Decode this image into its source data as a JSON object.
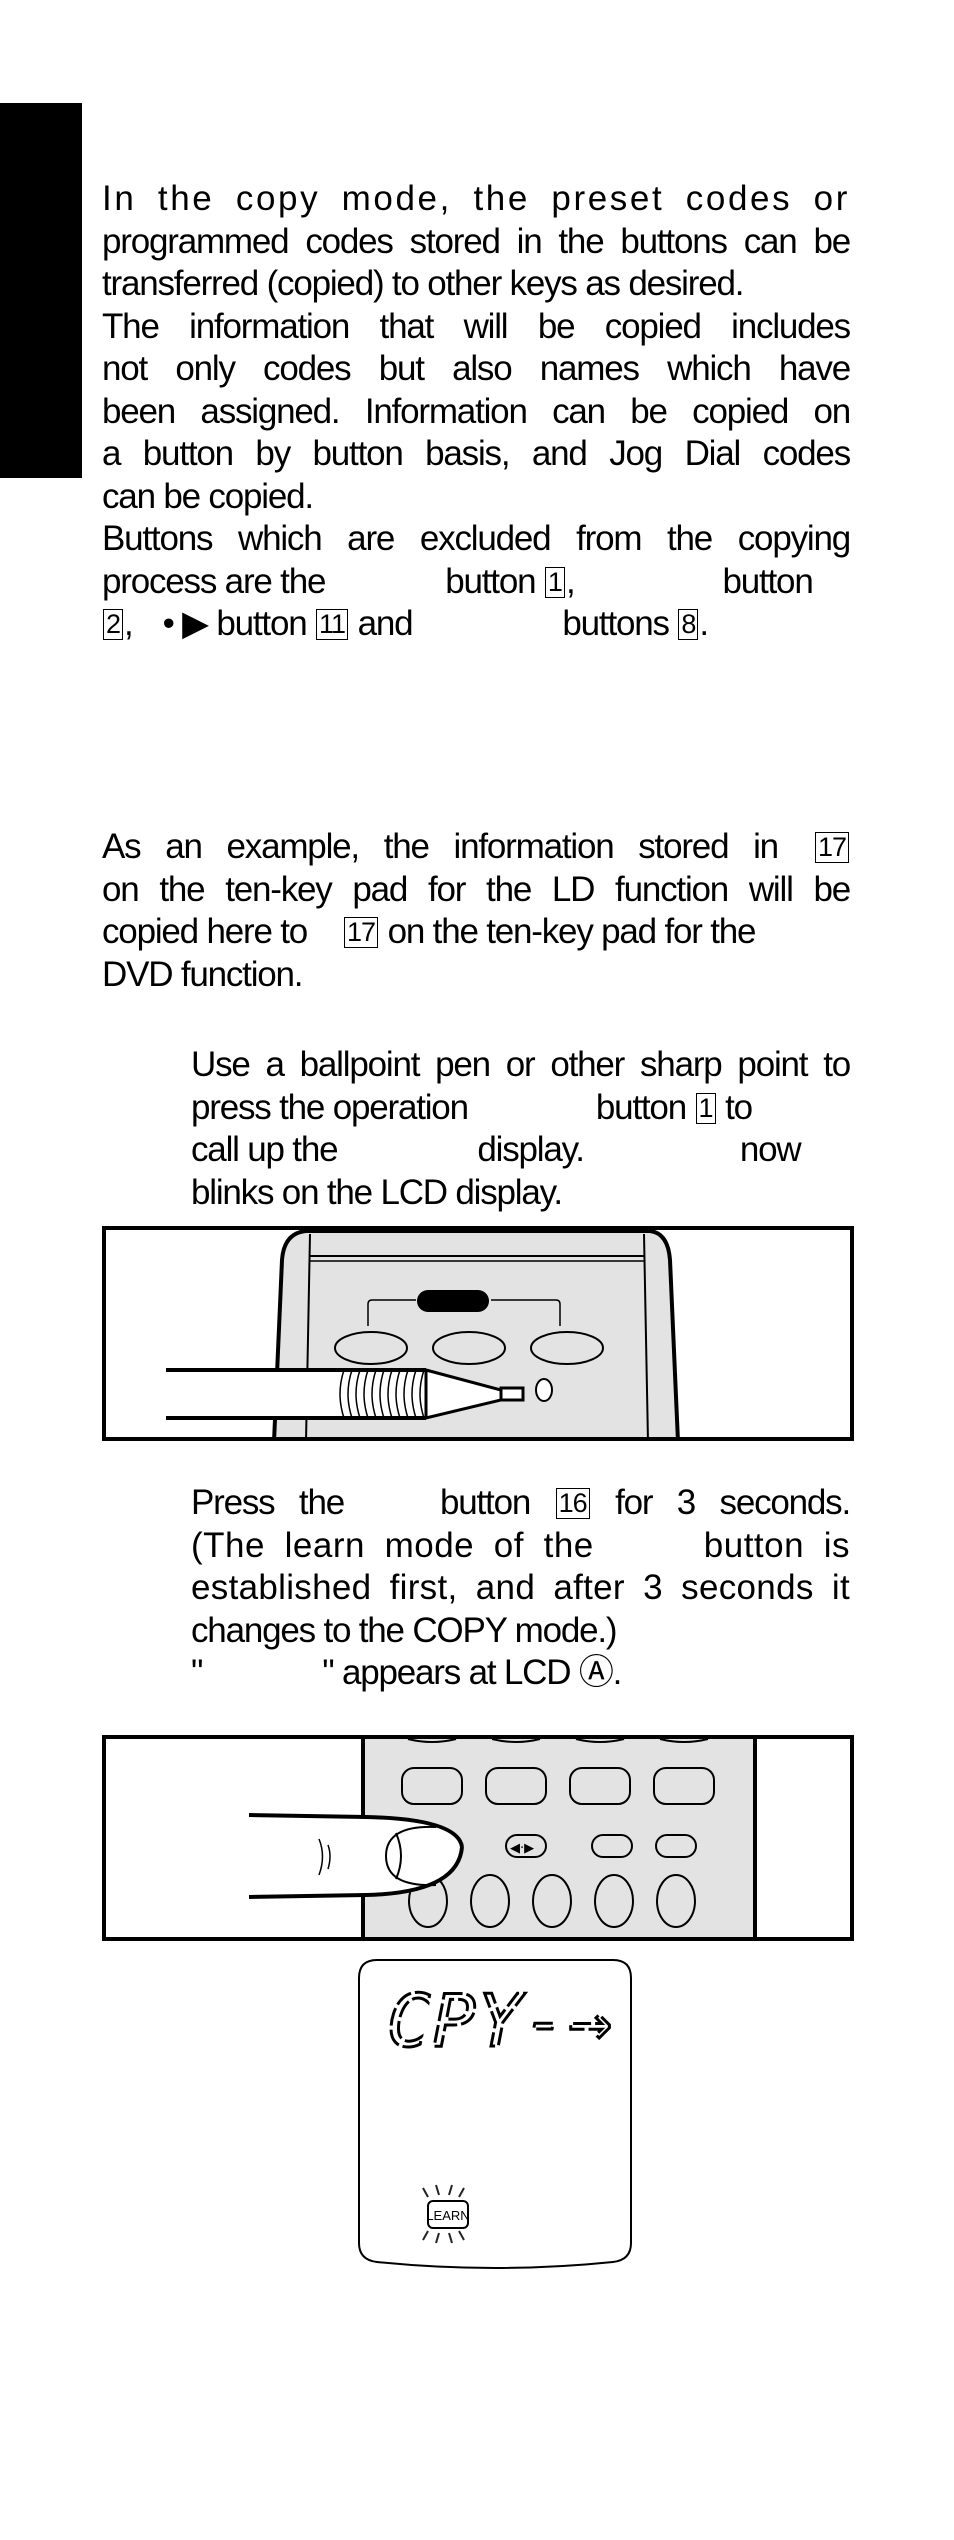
{
  "page": {
    "intro": {
      "lines": [
        "In the copy mode, the preset codes or",
        "programmed codes stored in the buttons can be",
        "transferred (copied) to other keys as desired.",
        "The information that will be copied includes",
        "not only codes but also names which have",
        "been assigned.  Information can be copied on",
        "a button by button basis, and Jog Dial codes",
        "can be copied."
      ]
    },
    "excluded": {
      "line1": "Buttons which are excluded from the copying",
      "line2_a": "process are the",
      "line2_b": "button",
      "line2_num": "1",
      "line2_c": ",",
      "line2_d": "button",
      "line3_num1": "2",
      "line3_a": ",",
      "line3_b": "• ▶ button",
      "line3_num2": "11",
      "line3_c": "and",
      "line3_d": "buttons",
      "line3_num3": "8",
      "line3_e": "."
    },
    "example": {
      "line1_a": "As an example, the information stored in",
      "line1_num": "17",
      "line2": "on the ten-key pad for the LD function will be",
      "line3_a": "copied here to",
      "line3_num": "17",
      "line3_b": "on the ten-key pad for the",
      "line4": "DVD function."
    },
    "step1": {
      "line1": "Use a ballpoint pen or other sharp point to",
      "line2_a": "press the operation",
      "line2_b": "button",
      "line2_num": "1",
      "line2_c": "to",
      "line3_a": "call up the",
      "line3_b": "display.",
      "line3_c": "now",
      "line4": "blinks on the LCD display."
    },
    "step2": {
      "line1_a": "Press the",
      "line1_b": "button",
      "line1_num": "16",
      "line1_c": "for 3 seconds.",
      "line2_a": "(The learn mode of the",
      "line2_b": "button is",
      "line3": "established first, and after 3 seconds it",
      "line4": "changes to the COPY mode.)",
      "line5_a": "\"",
      "line5_b": "\" appears at LCD Ⓐ."
    },
    "lcd": {
      "segment_text": "CPY-→",
      "indicator_label": "LEARN"
    },
    "figures": {
      "fig1": "pen-pressing-operation-button",
      "fig2": "finger-pressing-button"
    }
  }
}
